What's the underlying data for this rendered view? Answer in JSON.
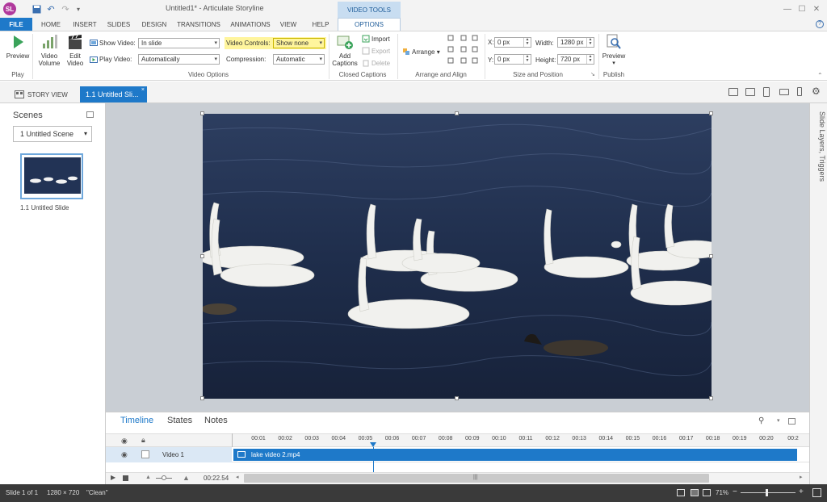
{
  "title_bar": {
    "app_logo": "SL",
    "window_title": "Untitled1* -  Articulate Storyline",
    "minimize_icon": "minimize-icon",
    "restore_icon": "restore-icon",
    "close_icon": "close-icon"
  },
  "tabs": {
    "file": "FILE",
    "items": [
      "HOME",
      "INSERT",
      "SLIDES",
      "DESIGN",
      "TRANSITIONS",
      "ANIMATIONS",
      "VIEW",
      "HELP"
    ],
    "contextual_group": "VIDEO TOOLS",
    "active": "OPTIONS"
  },
  "ribbon": {
    "play": {
      "preview": "Preview",
      "group": "Play"
    },
    "video_options": {
      "video_volume": "Video Volume",
      "edit_video": "Edit Video",
      "show_video_label": "Show Video:",
      "show_video_value": "In slide",
      "play_video_label": "Play Video:",
      "play_video_value": "Automatically",
      "video_controls_label": "Video Controls:",
      "video_controls_value": "Show none",
      "compression_label": "Compression:",
      "compression_value": "Automatic",
      "group": "Video Options"
    },
    "closed_captions": {
      "add": "Add Captions",
      "import": "Import",
      "export": "Export",
      "delete": "Delete",
      "group": "Closed Captions"
    },
    "arrange_align": {
      "arrange": "Arrange",
      "group": "Arrange and Align"
    },
    "size_position": {
      "x_label": "X:",
      "x_value": "0 px",
      "y_label": "Y:",
      "y_value": "0 px",
      "width_label": "Width:",
      "width_value": "1280 px",
      "height_label": "Height:",
      "height_value": "720 px",
      "group": "Size and Position"
    },
    "publish": {
      "preview": "Preview",
      "group": "Publish"
    }
  },
  "view_tabs": {
    "story_view": "STORY VIEW",
    "slide_tab": "1.1 Untitled Sli..."
  },
  "scenes_panel": {
    "title": "Scenes",
    "scene_select": "1 Untitled Scene",
    "thumbnail_caption": "1.1 Untitled Slide"
  },
  "right_panel": {
    "label": "Slide Layers, Triggers"
  },
  "timeline": {
    "tabs": [
      "Timeline",
      "States",
      "Notes"
    ],
    "active_tab": "Timeline",
    "ticks": [
      "00:01",
      "00:02",
      "00:03",
      "00:04",
      "00:05",
      "00:06",
      "00:07",
      "00:08",
      "00:09",
      "00:10",
      "00:11",
      "00:12",
      "00:13",
      "00:14",
      "00:15",
      "00:16",
      "00:17",
      "00:18",
      "00:19",
      "00:20",
      "00:2"
    ],
    "row_name": "Video 1",
    "clip_name": "lake video 2.mp4",
    "duration": "00:22.54"
  },
  "status_bar": {
    "slide": "Slide 1 of 1",
    "size": "1280 × 720",
    "theme": "\"Clean\"",
    "zoom": "71%"
  },
  "colors": {
    "accent": "#1e79c9",
    "highlight": "#fff59d",
    "logo": "#b0399c",
    "status_bar": "#3a3a3a"
  }
}
